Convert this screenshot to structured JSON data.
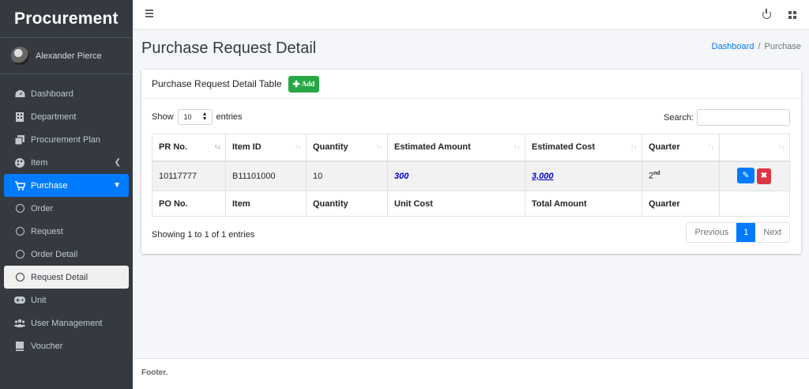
{
  "brand": "Procurement",
  "user": {
    "name": "Alexander Pierce"
  },
  "sidebar": {
    "items": [
      {
        "label": "Dashboard"
      },
      {
        "label": "Department"
      },
      {
        "label": "Procurement Plan"
      },
      {
        "label": "Item"
      },
      {
        "label": "Purchase"
      },
      {
        "label": "Order"
      },
      {
        "label": "Request"
      },
      {
        "label": "Order Detail"
      },
      {
        "label": "Request Detail"
      },
      {
        "label": "Unit"
      },
      {
        "label": "User Management"
      },
      {
        "label": "Voucher"
      }
    ]
  },
  "header": {
    "title": "Purchase Request Detail",
    "breadcrumb": {
      "home": "Dashboard",
      "separator": "/",
      "current": "Purchase"
    }
  },
  "card": {
    "title": "Purchase Request Detail Table",
    "add_label": "Add",
    "show_label": "Show",
    "entries_value": "10",
    "entries_label": "entries",
    "search_label": "Search:",
    "search_value": ""
  },
  "table": {
    "headers": [
      "PR No.",
      "Item ID",
      "Quantity",
      "Estimated Amount",
      "Estimated Cost",
      "Quarter"
    ],
    "row": {
      "pr_no": "10117777",
      "item_id": "B11101000",
      "quantity": "10",
      "estimated_amount": "300",
      "estimated_cost": "3,000",
      "quarter_num": "2",
      "quarter_sup": "nd"
    },
    "footer": [
      "PO No.",
      "Item",
      "Quantity",
      "Unit Cost",
      "Total Amount",
      "Quarter"
    ]
  },
  "pagination": {
    "info": "Showing 1 to 1 of 1 entries",
    "previous": "Previous",
    "current": "1",
    "next": "Next"
  },
  "footer": {
    "text": "Footer."
  },
  "colors": {
    "sidebar_bg": "#343a40",
    "primary": "#007bff",
    "success": "#28a745",
    "danger": "#dc3545"
  }
}
